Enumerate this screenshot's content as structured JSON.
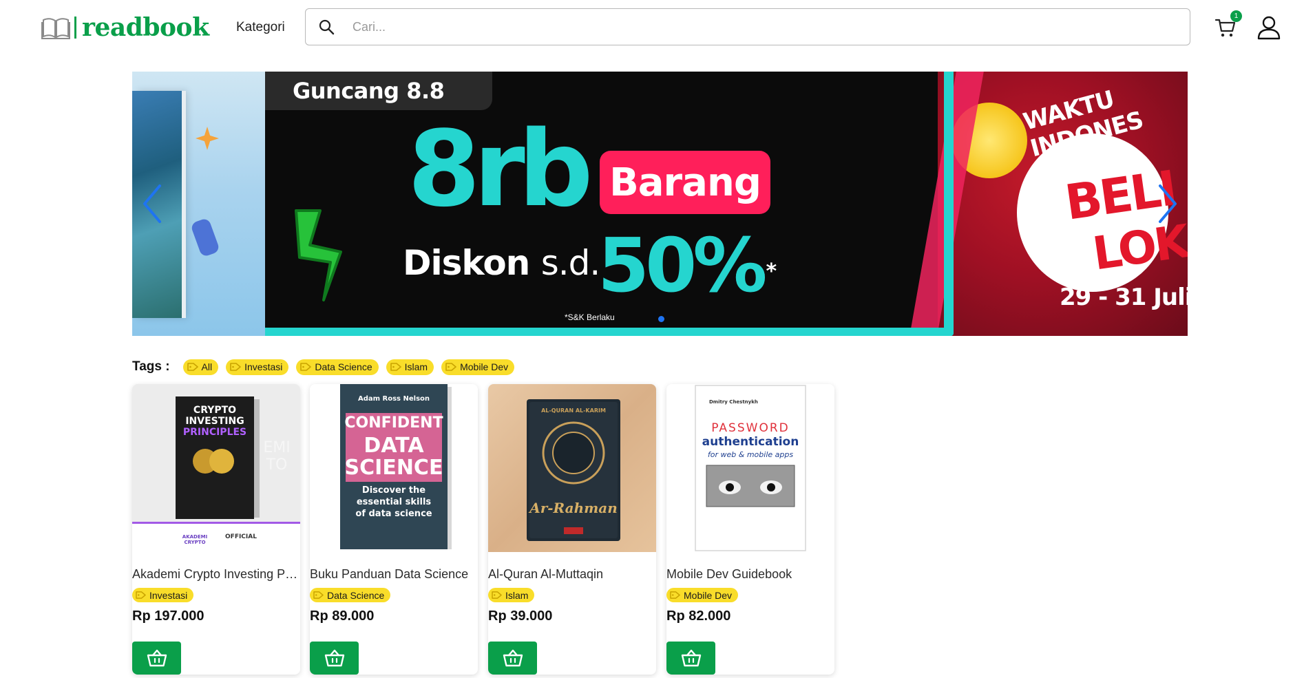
{
  "header": {
    "logo_text": "readbook",
    "kategori_label": "Kategori",
    "search_placeholder": "Cari...",
    "cart_count": "1",
    "icons": [
      "book-logo-icon",
      "search-icon",
      "cart-icon",
      "user-icon"
    ]
  },
  "banner": {
    "guncang": "Guncang 8.8",
    "big": "8rb",
    "barang": "Barang",
    "diskon": "Diskon",
    "sd": "s.d.",
    "percent": "50%",
    "asterisk": "*",
    "snk": "*S&K Berlaku",
    "waktu": "WAKTU INDONES",
    "beli": "BELI",
    "lokal": "LOKA",
    "tanggal": "29 - 31 Juli",
    "active_slide": 1,
    "colors": {
      "cyan": "#25d5cf",
      "pink": "#ff1f5a",
      "red": "#c21a2a"
    }
  },
  "tags": {
    "title": "Tags :",
    "items": [
      "All",
      "Investasi",
      "Data Science",
      "Islam",
      "Mobile Dev"
    ],
    "color": "#f9dd2a"
  },
  "products": [
    {
      "title": "Akademi Crypto Investing Pri...",
      "tag": "Investasi",
      "price": "Rp 197.000",
      "cover": {
        "line1": "CRYPTO",
        "line2": "INVESTING",
        "line3": "PRINCIPLES",
        "footer_brand": "AKADEMI CRYPTO",
        "footer_official": "OFFICIAL",
        "watermark": "EMI TO"
      }
    },
    {
      "title": "Buku Panduan Data Science",
      "tag": "Data Science",
      "price": "Rp 89.000",
      "cover": {
        "author": "Adam Ross Nelson",
        "line1": "CONFIDENT",
        "line2": "DATA",
        "line3": "SCIENCE",
        "sub": "Discover the essential skills of data science"
      }
    },
    {
      "title": "Al-Quran Al-Muttaqin",
      "tag": "Islam",
      "price": "Rp 39.000",
      "cover": {
        "top": "AL-QURAN AL-KARIM",
        "name": "Ar-Rahman"
      }
    },
    {
      "title": "Mobile Dev Guidebook",
      "tag": "Mobile Dev",
      "price": "Rp 82.000",
      "cover": {
        "author": "Dmitry Chestnykh",
        "line1": "PASSWORD",
        "line2": "authentication",
        "line3": "for web & mobile apps"
      }
    }
  ],
  "buy_icon": "basket-icon",
  "brand_color": "#0a9f4a"
}
